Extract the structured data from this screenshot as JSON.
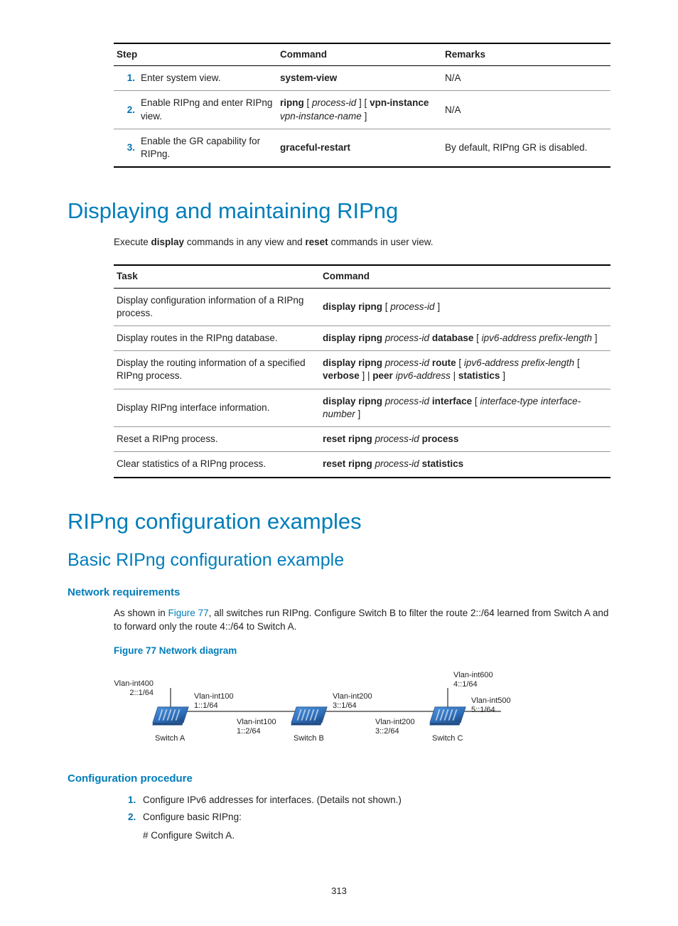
{
  "steps_table": {
    "headers": {
      "step": "Step",
      "command": "Command",
      "remarks": "Remarks"
    },
    "rows": [
      {
        "num": "1.",
        "step": "Enter system view.",
        "cmd_bold1": "system-view",
        "remarks": "N/A"
      },
      {
        "num": "2.",
        "step": "Enable RIPng and enter RIPng view.",
        "cmd_bold1": "ripng",
        "cmd_ital1": "process-id",
        "cmd_bold2": "vpn-instance",
        "cmd_ital2": "vpn-instance-name",
        "remarks": "N/A"
      },
      {
        "num": "3.",
        "step": "Enable the GR capability for RIPng.",
        "cmd_bold1": "graceful-restart",
        "remarks": "By default, RIPng GR is disabled."
      }
    ]
  },
  "h1_display": "Displaying and maintaining RIPng",
  "intro_display_pre": "Execute ",
  "intro_display_b1": "display",
  "intro_display_mid": " commands in any view and ",
  "intro_display_b2": "reset",
  "intro_display_post": " commands in user view.",
  "task_table": {
    "headers": {
      "task": "Task",
      "command": "Command"
    },
    "rows": [
      {
        "task": "Display configuration information of a RIPng process.",
        "c_b1": "display ripng",
        "c_i1": "process-id"
      },
      {
        "task": "Display routes in the RIPng database.",
        "c_b1": "display ripng",
        "c_i1": "process-id",
        "c_b2": "database",
        "c_i2": "ipv6-address prefix-length"
      },
      {
        "task": "Display the routing information of a specified RIPng process.",
        "c_b1": "display ripng",
        "c_i1": "process-id",
        "c_b2": "route",
        "c_i2": "ipv6-address prefix-length",
        "c_b3": "verbose",
        "c_b4": "peer",
        "c_i3": "ipv6-address",
        "c_b5": "statistics"
      },
      {
        "task": "Display RIPng interface information.",
        "c_b1": "display ripng",
        "c_i1": "process-id",
        "c_b2": "interface",
        "c_i2": "interface-type interface-number"
      },
      {
        "task": "Reset a RIPng process.",
        "c_b1": "reset ripng",
        "c_i1": "process-id",
        "c_b2": "process"
      },
      {
        "task": "Clear statistics of a RIPng process.",
        "c_b1": "reset ripng",
        "c_i1": "process-id",
        "c_b2": "statistics"
      }
    ]
  },
  "h1_examples": "RIPng configuration examples",
  "h2_basic": "Basic RIPng configuration example",
  "h3_netreq": "Network requirements",
  "netreq_pre": "As shown in ",
  "netreq_link": "Figure 77",
  "netreq_post": ", all switches run RIPng. Configure Switch B to filter the route 2::/64 learned from Switch A and to forward only the route 4::/64 to Switch A.",
  "figcap": "Figure 77 Network diagram",
  "diagram": {
    "switchA": "Switch A",
    "switchB": "Switch B",
    "switchC": "Switch C",
    "a_top": "Vlan-int400\n2::1/64",
    "a_right": "Vlan-int100\n1::1/64",
    "b_left": "Vlan-int100\n1::2/64",
    "b_right": "Vlan-int200\n3::1/64",
    "c_left": "Vlan-int200\n3::2/64",
    "c_top": "Vlan-int600\n4::1/64",
    "c_right": "Vlan-int500\n5::1/64"
  },
  "h3_confproc": "Configuration procedure",
  "proc": {
    "s1": "Configure IPv6 addresses for interfaces. (Details not shown.)",
    "s2": "Configure basic RIPng:",
    "s2sub": "# Configure Switch A."
  },
  "pagenum": "313"
}
